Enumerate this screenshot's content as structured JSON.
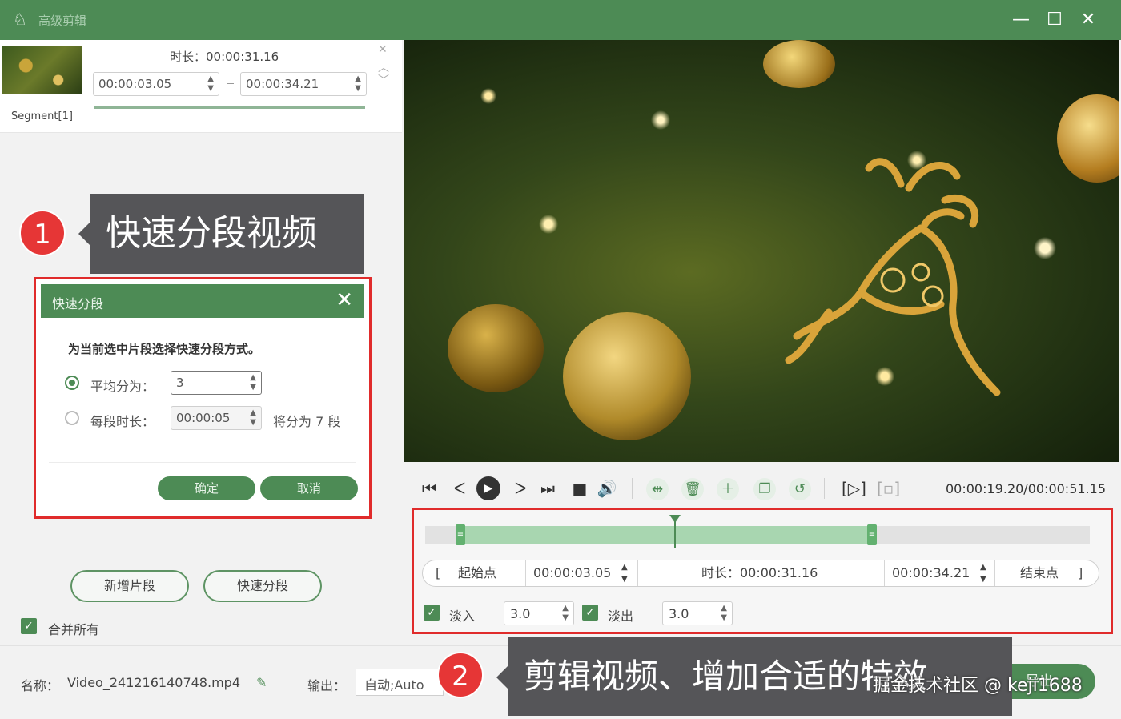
{
  "window": {
    "title": "高级剪辑",
    "minimize": "—",
    "maximize": "☐",
    "close": "✕"
  },
  "segment": {
    "name": "Segment[1]",
    "duration_label": "时长：00:00:31.16",
    "start": "00:00:03.05",
    "end": "00:00:34.21"
  },
  "callouts": {
    "one": {
      "number": "1",
      "text": "快速分段视频"
    },
    "two": {
      "number": "2",
      "text": "剪辑视频、增加合适的特效"
    }
  },
  "dialog": {
    "title": "快速分段",
    "prompt": "为当前选中片段选择快速分段方式。",
    "option_even_label": "平均分为：",
    "option_even_value": "3",
    "option_each_label": "每段时长：",
    "option_each_value": "00:00:05",
    "option_each_note": "将分为 7 段",
    "confirm": "确定",
    "cancel": "取消"
  },
  "left_actions": {
    "add_segment": "新增片段",
    "quick_split": "快速分段",
    "merge_all": "合并所有"
  },
  "player": {
    "timecode": "00:00:19.20/00:00:51.15",
    "playback_fraction": 0.375
  },
  "timeline": {
    "start_label": "起始点",
    "start_value": "00:00:03.05",
    "duration_label": "时长：00:00:31.16",
    "end_value": "00:00:34.21",
    "end_label": "结束点",
    "fade_in_label": "淡入",
    "fade_in_value": "3.0",
    "fade_out_label": "淡出",
    "fade_out_value": "3.0"
  },
  "bottom": {
    "name_label": "名称：",
    "filename": "Video_241216140748.mp4",
    "output_label": "输出：",
    "output_value": "自动;Auto",
    "export_label": "导出"
  },
  "watermark": "掘金技术社区 @ keji1688",
  "colors": {
    "accent": "#4d8b55",
    "highlight": "#e02b2b",
    "callout": "#555558"
  }
}
